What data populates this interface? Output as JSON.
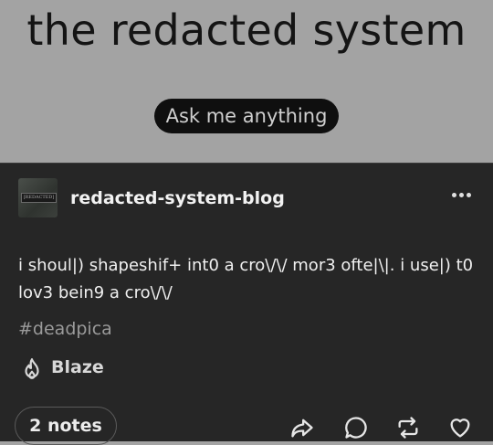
{
  "header": {
    "title": "the redacted system",
    "ask_label": "Ask me anything"
  },
  "post": {
    "avatar_text": "[REDACTED]",
    "blog_name": "redacted-system-blog",
    "more_icon": "more-horizontal-icon",
    "body": "i shoul|) shapeshif+ int0 a cro\\/\\/ mor3 ofte|\\|. i use|) t0 lov3 bein9 a cro\\/\\/",
    "tag": "#deadpica",
    "blaze_label": "Blaze",
    "notes_label": "2 notes"
  },
  "actions": {
    "icons": [
      "share-icon",
      "reply-icon",
      "reblog-icon",
      "like-icon"
    ]
  },
  "colors": {
    "page_bg": "#a3a3a3",
    "post_bg": "#262626",
    "pill_bg": "#0f0f0f"
  }
}
